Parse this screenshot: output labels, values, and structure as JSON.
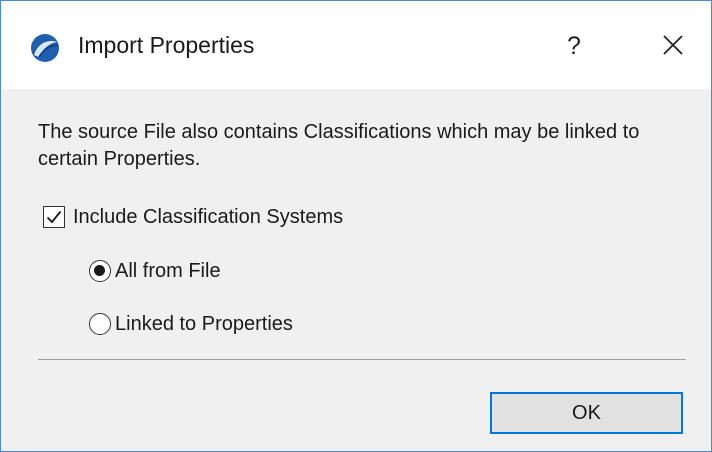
{
  "dialog": {
    "title": "Import Properties",
    "help_label": "?",
    "message": "The source File also contains Classifications which may be linked to certain Properties.",
    "checkbox": {
      "label": "Include Classification Systems",
      "checked": true
    },
    "radio_options": [
      {
        "label": "All from File",
        "selected": true
      },
      {
        "label": "Linked to Properties",
        "selected": false
      }
    ],
    "ok_label": "OK"
  },
  "colors": {
    "accent": "#0078d7",
    "window_border": "#4a8ad4",
    "app_icon": "#1f5fb0"
  }
}
